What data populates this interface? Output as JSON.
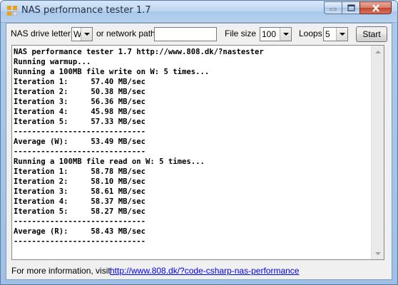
{
  "window": {
    "title": "NAS performance tester 1.7",
    "accent": "#aac8ea"
  },
  "toolbar": {
    "drive_label": "NAS drive letter",
    "drive_value": "W",
    "network_label": "or network path",
    "network_value": "",
    "filesize_label": "File size",
    "filesize_value": "100",
    "loops_label": "Loops",
    "loops_value": "5",
    "start_label": "Start"
  },
  "output": {
    "lines": [
      "NAS performance tester 1.7 http://www.808.dk/?nastester",
      "Running warmup...",
      "Running a 100MB file write on W: 5 times...",
      "Iteration 1:     57.40 MB/sec",
      "Iteration 2:     50.38 MB/sec",
      "Iteration 3:     56.36 MB/sec",
      "Iteration 4:     45.98 MB/sec",
      "Iteration 5:     57.33 MB/sec",
      "-----------------------------",
      "Average (W):     53.49 MB/sec",
      "-----------------------------",
      "Running a 100MB file read on W: 5 times...",
      "Iteration 1:     58.78 MB/sec",
      "Iteration 2:     58.10 MB/sec",
      "Iteration 3:     58.61 MB/sec",
      "Iteration 4:     58.37 MB/sec",
      "Iteration 5:     58.27 MB/sec",
      "-----------------------------",
      "Average (R):     58.43 MB/sec",
      "-----------------------------"
    ]
  },
  "footer": {
    "info_text": "For more information, visit",
    "link_text": "http://www.808.dk/?code-csharp-nas-performance"
  }
}
